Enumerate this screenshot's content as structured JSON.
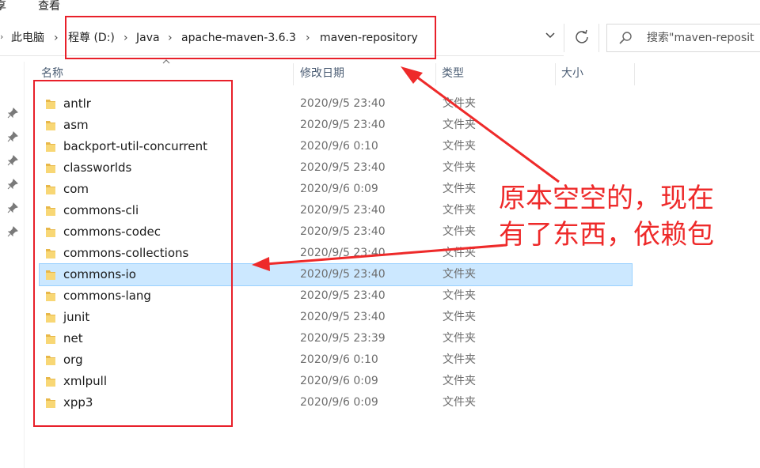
{
  "menu": {
    "share": "享",
    "view": "查看"
  },
  "breadcrumb": [
    "此电脑",
    "程尊 (D:)",
    "Java",
    "apache-maven-3.6.3",
    "maven-repository"
  ],
  "search": {
    "placeholder": "搜索\"maven-reposit"
  },
  "columns": {
    "name": "名称",
    "modified": "修改日期",
    "type": "类型",
    "size": "大小"
  },
  "files": [
    {
      "name": "antlr",
      "date": "2020/9/5 23:40",
      "type": "文件夹"
    },
    {
      "name": "asm",
      "date": "2020/9/5 23:40",
      "type": "文件夹"
    },
    {
      "name": "backport-util-concurrent",
      "date": "2020/9/6 0:10",
      "type": "文件夹"
    },
    {
      "name": "classworlds",
      "date": "2020/9/5 23:40",
      "type": "文件夹"
    },
    {
      "name": "com",
      "date": "2020/9/6 0:09",
      "type": "文件夹"
    },
    {
      "name": "commons-cli",
      "date": "2020/9/5 23:40",
      "type": "文件夹"
    },
    {
      "name": "commons-codec",
      "date": "2020/9/5 23:40",
      "type": "文件夹"
    },
    {
      "name": "commons-collections",
      "date": "2020/9/5 23:40",
      "type": "文件夹"
    },
    {
      "name": "commons-io",
      "date": "2020/9/5 23:40",
      "type": "文件夹",
      "selected": true
    },
    {
      "name": "commons-lang",
      "date": "2020/9/5 23:40",
      "type": "文件夹"
    },
    {
      "name": "junit",
      "date": "2020/9/5 23:40",
      "type": "文件夹"
    },
    {
      "name": "net",
      "date": "2020/9/5 23:39",
      "type": "文件夹"
    },
    {
      "name": "org",
      "date": "2020/9/6 0:10",
      "type": "文件夹"
    },
    {
      "name": "xmlpull",
      "date": "2020/9/6 0:09",
      "type": "文件夹"
    },
    {
      "name": "xpp3",
      "date": "2020/9/6 0:09",
      "type": "文件夹"
    }
  ],
  "annotation": {
    "line1": "原本空空的，现在",
    "line2": "有了东西，依赖包"
  },
  "colors": {
    "selection": "#cce8ff",
    "annotation": "#ee2a2a",
    "folder": "#f8d775"
  }
}
